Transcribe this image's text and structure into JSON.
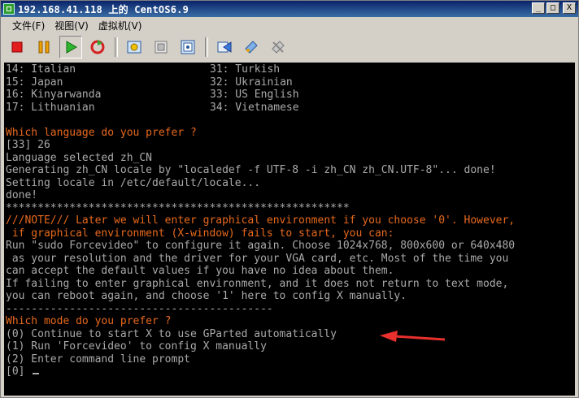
{
  "window": {
    "title": "192.168.41.118 上的 CentOS6.9",
    "minimize": "_",
    "maximize": "□",
    "close": "X"
  },
  "menu": [
    "文件(F)",
    "视图(V)",
    "虚拟机(V)"
  ],
  "toolbar_icons": [
    "stop-icon",
    "pause-icon",
    "play-icon",
    "reset-icon",
    "snapshot-icon",
    "revert-snapshot-icon",
    "manage-snapshots-icon",
    "settings-icon",
    "connect-device-icon",
    "disconnect-device-icon"
  ],
  "colors": {
    "console_text": "#aaaaaa",
    "console_highlight": "#e8691c",
    "console_bg": "#000000",
    "arrow": "#e8302c"
  },
  "console": {
    "languages": [
      {
        "left": "14: Italian",
        "right": "31: Turkish"
      },
      {
        "left": "15: Japan",
        "right": "32: Ukrainian"
      },
      {
        "left": "16: Kinyarwanda",
        "right": "33: US English"
      },
      {
        "left": "17: Lithuanian",
        "right": "34: Vietnamese"
      }
    ],
    "lines": [
      {
        "text": "",
        "style": "grey"
      },
      {
        "text": "Which language do you prefer ?",
        "style": "orange"
      },
      {
        "text": "[33] 26",
        "style": "grey"
      },
      {
        "text": "Language selected zh_CN",
        "style": "grey"
      },
      {
        "text": "Generating zh_CN locale by \"localedef -f UTF-8 -i zh_CN zh_CN.UTF-8\"... done!",
        "style": "grey"
      },
      {
        "text": "Setting locale in /etc/default/locale...",
        "style": "grey"
      },
      {
        "text": "done!",
        "style": "grey"
      },
      {
        "text": "******************************************************",
        "style": "grey"
      },
      {
        "text": "///NOTE/// Later we will enter graphical environment if you choose '0'. However,",
        "style": "orange"
      },
      {
        "text": " if graphical environment (X-window) fails to start, you can:",
        "style": "orange"
      },
      {
        "text": "Run \"sudo Forcevideo\" to configure it again. Choose 1024x768, 800x600 or 640x480",
        "style": "grey"
      },
      {
        "text": " as your resolution and the driver for your VGA card, etc. Most of the time you",
        "style": "grey"
      },
      {
        "text": "can accept the default values if you have no idea about them.",
        "style": "grey"
      },
      {
        "text": "If failing to enter graphical environment, and it does not return to text mode,",
        "style": "grey"
      },
      {
        "text": "you can reboot again, and choose '1' here to config X manually.",
        "style": "grey"
      },
      {
        "text": "------------------------------------------",
        "style": "grey"
      },
      {
        "text": "Which mode do you prefer ?",
        "style": "orange"
      },
      {
        "text": "(0) Continue to start X to use GParted automatically",
        "style": "grey"
      },
      {
        "text": "(1) Run 'Forcevideo' to config X manually",
        "style": "grey"
      },
      {
        "text": "(2) Enter command line prompt",
        "style": "grey"
      }
    ],
    "prompt": "[0]"
  }
}
